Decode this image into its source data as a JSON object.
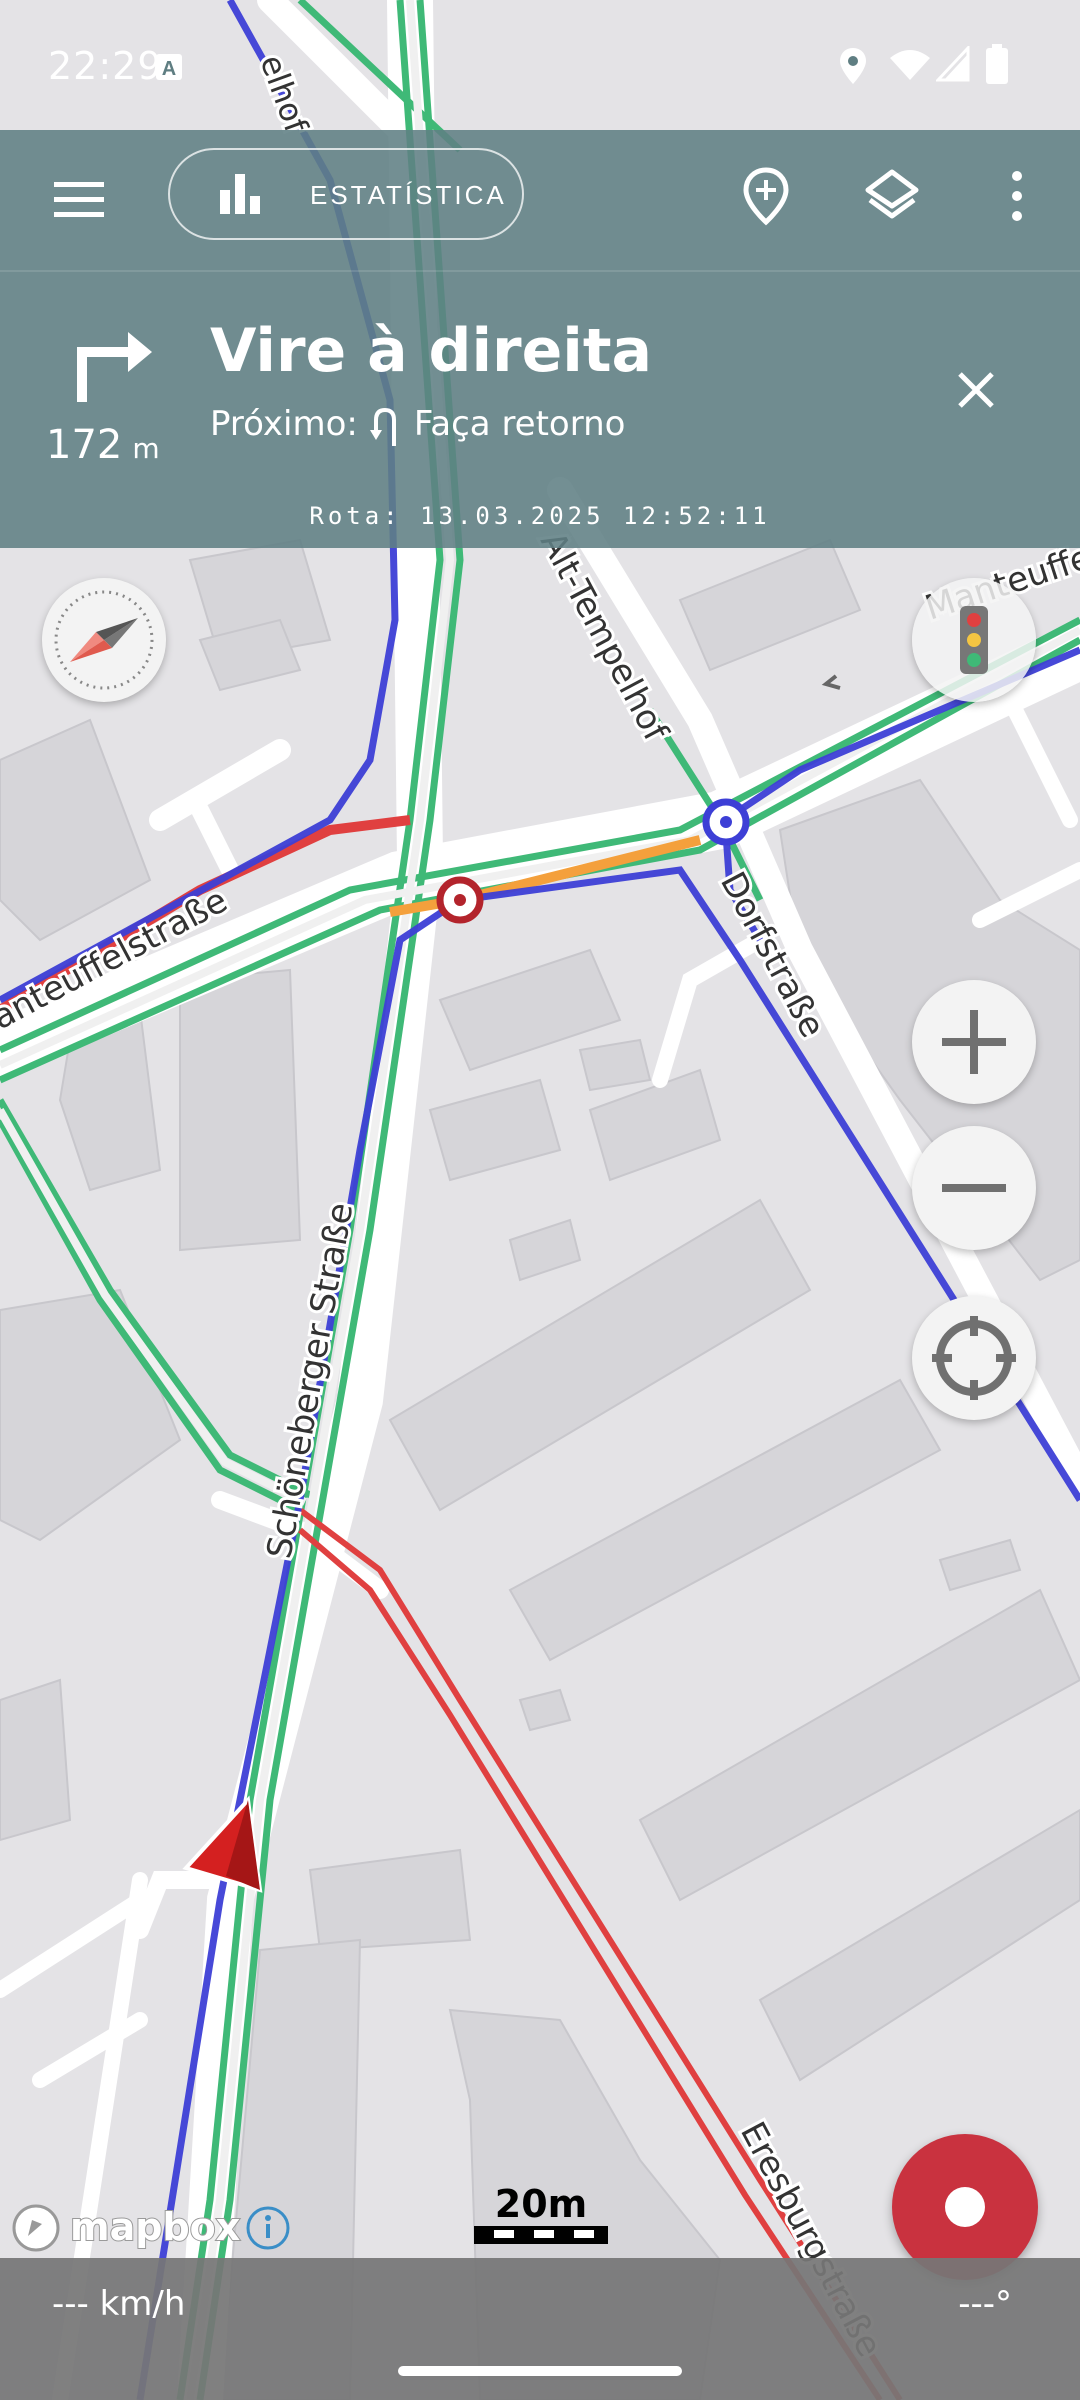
{
  "status_bar": {
    "time": "22:29",
    "icons": [
      "a-notification-icon",
      "location-icon",
      "wifi-icon",
      "signal-icon",
      "battery-icon"
    ]
  },
  "toolbar": {
    "stats_label": "ESTATÍSTICA",
    "icons": [
      "menu-icon",
      "bar-chart-icon",
      "add-location-icon",
      "layers-icon",
      "more-vert-icon"
    ]
  },
  "navigation": {
    "instruction": "Vire à direita",
    "distance_value": "172",
    "distance_unit": "m",
    "next_label": "Próximo:",
    "next_instruction": "Faça retorno",
    "route_info": "Rota: 13.03.2025 12:52:11"
  },
  "map": {
    "streets": [
      "Alt-Tempelhof",
      "anteuffelstraße",
      "Schöneberger Straße",
      "Eresburgstraße",
      "Dorfstraße",
      "Manteuffelstraße"
    ],
    "attribution": "mapbox",
    "scale_label": "20m",
    "colors": {
      "route": "#3d3fd6",
      "path_green": "#3fb977",
      "path_red": "#e04040",
      "path_orange": "#f4a03c",
      "arrow": "#d42020",
      "record": "#c9323f"
    }
  },
  "bottom_bar": {
    "speed": "--- km/h",
    "heading": "---°"
  }
}
